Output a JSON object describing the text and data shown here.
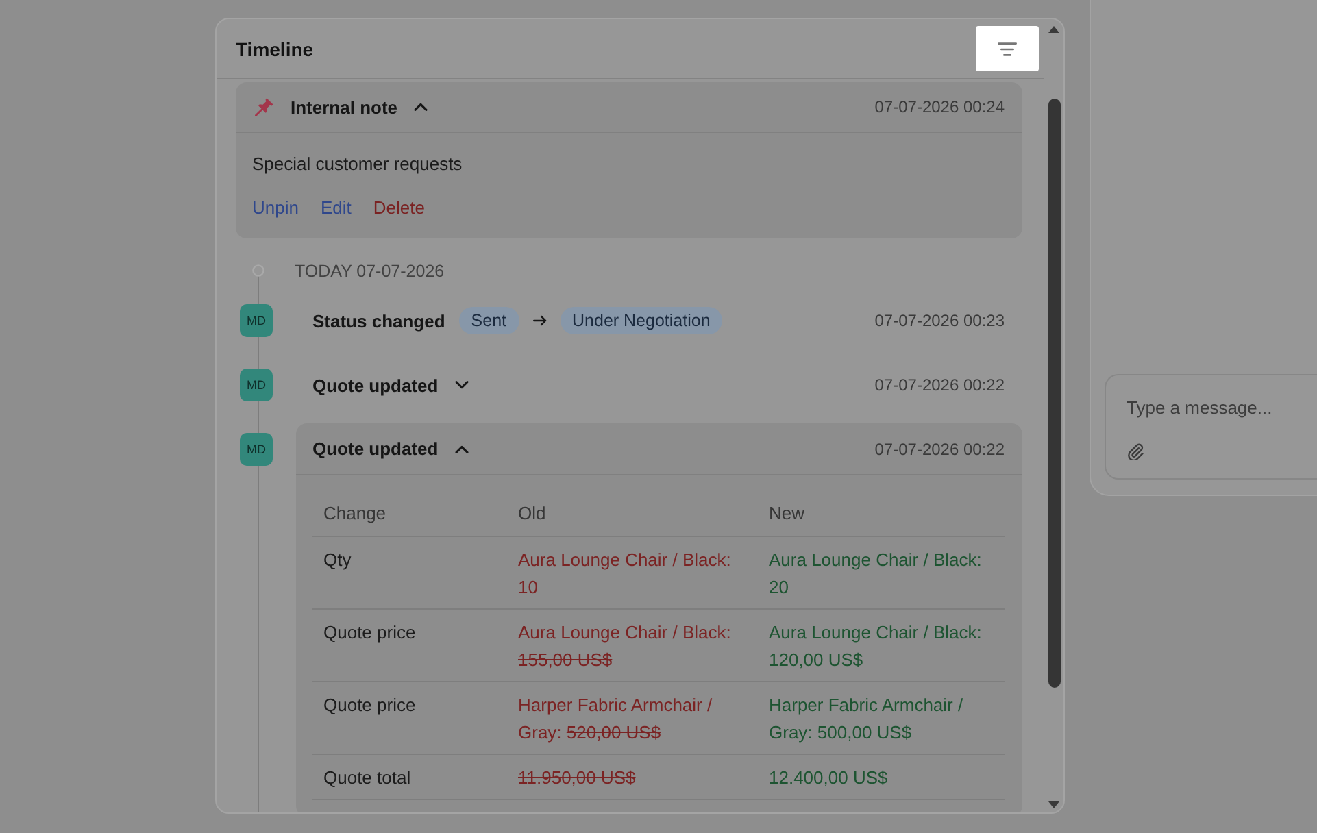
{
  "timeline": {
    "title": "Timeline",
    "filter_button": {
      "spotlighted": true
    },
    "pinned_note": {
      "title": "Internal note",
      "expanded": true,
      "time": "07-07-2026 00:24",
      "text": "Special customer requests",
      "actions": [
        {
          "label": "Unpin",
          "kind": "link"
        },
        {
          "label": "Edit",
          "kind": "link"
        },
        {
          "label": "Delete",
          "kind": "danger"
        }
      ]
    },
    "day_label": "TODAY 07-07-2026",
    "events": [
      {
        "kind": "status",
        "avatar": "MD",
        "title": "Status changed",
        "from": "Sent",
        "to": "Under Negotiation",
        "time": "07-07-2026 00:23"
      },
      {
        "kind": "update",
        "avatar": "MD",
        "title": "Quote updated",
        "expanded": false,
        "time": "07-07-2026 00:22"
      },
      {
        "kind": "update",
        "avatar": "MD",
        "title": "Quote updated",
        "expanded": true,
        "time": "07-07-2026 00:22",
        "changes": {
          "columns": [
            "Change",
            "Old",
            "New"
          ],
          "rows": [
            {
              "change": "Qty",
              "old": {
                "item": "Aura Lounge Chair / Black:",
                "value": "10",
                "struck": false
              },
              "new": {
                "item": "Aura Lounge Chair / Black:",
                "value": "20"
              }
            },
            {
              "change": "Quote price",
              "old": {
                "item": "Aura Lounge Chair / Black:",
                "value": "155,00 US$",
                "struck": true
              },
              "new": {
                "item": "Aura Lounge Chair / Black:",
                "value": "120,00 US$"
              }
            },
            {
              "change": "Quote price",
              "old": {
                "item": "Harper Fabric Armchair / Gray:",
                "value": "520,00 US$",
                "struck": true
              },
              "new": {
                "item": "Harper Fabric Armchair / Gray:",
                "value": "500,00 US$"
              }
            },
            {
              "change": "Quote total",
              "old": {
                "value": "11.950,00 US$",
                "struck": true
              },
              "new": {
                "value": "12.400,00 US$"
              }
            }
          ]
        }
      }
    ]
  },
  "chat": {
    "message_field": {
      "placeholder": "Type a message..."
    }
  }
}
